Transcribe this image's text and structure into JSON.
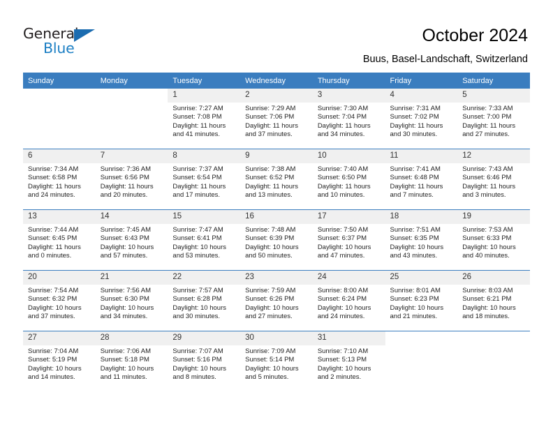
{
  "brand": {
    "name_top": "General",
    "name_bottom": "Blue",
    "color_dark": "#231f20",
    "color_blue": "#1c7fc4",
    "triangle_color": "#1b6cb0"
  },
  "header": {
    "title": "October 2024",
    "subtitle": "Buus, Basel-Landschaft, Switzerland"
  },
  "theme": {
    "header_row_bg": "#3a7dbf",
    "daynum_bg": "#f0f0f0",
    "grid_line": "#3a7dbf"
  },
  "weekdays": [
    "Sunday",
    "Monday",
    "Tuesday",
    "Wednesday",
    "Thursday",
    "Friday",
    "Saturday"
  ],
  "weeks": [
    [
      {
        "day": "",
        "empty": true
      },
      {
        "day": "",
        "empty": true
      },
      {
        "day": "1",
        "sunrise": "Sunrise: 7:27 AM",
        "sunset": "Sunset: 7:08 PM",
        "daylight1": "Daylight: 11 hours",
        "daylight2": "and 41 minutes."
      },
      {
        "day": "2",
        "sunrise": "Sunrise: 7:29 AM",
        "sunset": "Sunset: 7:06 PM",
        "daylight1": "Daylight: 11 hours",
        "daylight2": "and 37 minutes."
      },
      {
        "day": "3",
        "sunrise": "Sunrise: 7:30 AM",
        "sunset": "Sunset: 7:04 PM",
        "daylight1": "Daylight: 11 hours",
        "daylight2": "and 34 minutes."
      },
      {
        "day": "4",
        "sunrise": "Sunrise: 7:31 AM",
        "sunset": "Sunset: 7:02 PM",
        "daylight1": "Daylight: 11 hours",
        "daylight2": "and 30 minutes."
      },
      {
        "day": "5",
        "sunrise": "Sunrise: 7:33 AM",
        "sunset": "Sunset: 7:00 PM",
        "daylight1": "Daylight: 11 hours",
        "daylight2": "and 27 minutes."
      }
    ],
    [
      {
        "day": "6",
        "sunrise": "Sunrise: 7:34 AM",
        "sunset": "Sunset: 6:58 PM",
        "daylight1": "Daylight: 11 hours",
        "daylight2": "and 24 minutes."
      },
      {
        "day": "7",
        "sunrise": "Sunrise: 7:36 AM",
        "sunset": "Sunset: 6:56 PM",
        "daylight1": "Daylight: 11 hours",
        "daylight2": "and 20 minutes."
      },
      {
        "day": "8",
        "sunrise": "Sunrise: 7:37 AM",
        "sunset": "Sunset: 6:54 PM",
        "daylight1": "Daylight: 11 hours",
        "daylight2": "and 17 minutes."
      },
      {
        "day": "9",
        "sunrise": "Sunrise: 7:38 AM",
        "sunset": "Sunset: 6:52 PM",
        "daylight1": "Daylight: 11 hours",
        "daylight2": "and 13 minutes."
      },
      {
        "day": "10",
        "sunrise": "Sunrise: 7:40 AM",
        "sunset": "Sunset: 6:50 PM",
        "daylight1": "Daylight: 11 hours",
        "daylight2": "and 10 minutes."
      },
      {
        "day": "11",
        "sunrise": "Sunrise: 7:41 AM",
        "sunset": "Sunset: 6:48 PM",
        "daylight1": "Daylight: 11 hours",
        "daylight2": "and 7 minutes."
      },
      {
        "day": "12",
        "sunrise": "Sunrise: 7:43 AM",
        "sunset": "Sunset: 6:46 PM",
        "daylight1": "Daylight: 11 hours",
        "daylight2": "and 3 minutes."
      }
    ],
    [
      {
        "day": "13",
        "sunrise": "Sunrise: 7:44 AM",
        "sunset": "Sunset: 6:45 PM",
        "daylight1": "Daylight: 11 hours",
        "daylight2": "and 0 minutes."
      },
      {
        "day": "14",
        "sunrise": "Sunrise: 7:45 AM",
        "sunset": "Sunset: 6:43 PM",
        "daylight1": "Daylight: 10 hours",
        "daylight2": "and 57 minutes."
      },
      {
        "day": "15",
        "sunrise": "Sunrise: 7:47 AM",
        "sunset": "Sunset: 6:41 PM",
        "daylight1": "Daylight: 10 hours",
        "daylight2": "and 53 minutes."
      },
      {
        "day": "16",
        "sunrise": "Sunrise: 7:48 AM",
        "sunset": "Sunset: 6:39 PM",
        "daylight1": "Daylight: 10 hours",
        "daylight2": "and 50 minutes."
      },
      {
        "day": "17",
        "sunrise": "Sunrise: 7:50 AM",
        "sunset": "Sunset: 6:37 PM",
        "daylight1": "Daylight: 10 hours",
        "daylight2": "and 47 minutes."
      },
      {
        "day": "18",
        "sunrise": "Sunrise: 7:51 AM",
        "sunset": "Sunset: 6:35 PM",
        "daylight1": "Daylight: 10 hours",
        "daylight2": "and 43 minutes."
      },
      {
        "day": "19",
        "sunrise": "Sunrise: 7:53 AM",
        "sunset": "Sunset: 6:33 PM",
        "daylight1": "Daylight: 10 hours",
        "daylight2": "and 40 minutes."
      }
    ],
    [
      {
        "day": "20",
        "sunrise": "Sunrise: 7:54 AM",
        "sunset": "Sunset: 6:32 PM",
        "daylight1": "Daylight: 10 hours",
        "daylight2": "and 37 minutes."
      },
      {
        "day": "21",
        "sunrise": "Sunrise: 7:56 AM",
        "sunset": "Sunset: 6:30 PM",
        "daylight1": "Daylight: 10 hours",
        "daylight2": "and 34 minutes."
      },
      {
        "day": "22",
        "sunrise": "Sunrise: 7:57 AM",
        "sunset": "Sunset: 6:28 PM",
        "daylight1": "Daylight: 10 hours",
        "daylight2": "and 30 minutes."
      },
      {
        "day": "23",
        "sunrise": "Sunrise: 7:59 AM",
        "sunset": "Sunset: 6:26 PM",
        "daylight1": "Daylight: 10 hours",
        "daylight2": "and 27 minutes."
      },
      {
        "day": "24",
        "sunrise": "Sunrise: 8:00 AM",
        "sunset": "Sunset: 6:24 PM",
        "daylight1": "Daylight: 10 hours",
        "daylight2": "and 24 minutes."
      },
      {
        "day": "25",
        "sunrise": "Sunrise: 8:01 AM",
        "sunset": "Sunset: 6:23 PM",
        "daylight1": "Daylight: 10 hours",
        "daylight2": "and 21 minutes."
      },
      {
        "day": "26",
        "sunrise": "Sunrise: 8:03 AM",
        "sunset": "Sunset: 6:21 PM",
        "daylight1": "Daylight: 10 hours",
        "daylight2": "and 18 minutes."
      }
    ],
    [
      {
        "day": "27",
        "sunrise": "Sunrise: 7:04 AM",
        "sunset": "Sunset: 5:19 PM",
        "daylight1": "Daylight: 10 hours",
        "daylight2": "and 14 minutes."
      },
      {
        "day": "28",
        "sunrise": "Sunrise: 7:06 AM",
        "sunset": "Sunset: 5:18 PM",
        "daylight1": "Daylight: 10 hours",
        "daylight2": "and 11 minutes."
      },
      {
        "day": "29",
        "sunrise": "Sunrise: 7:07 AM",
        "sunset": "Sunset: 5:16 PM",
        "daylight1": "Daylight: 10 hours",
        "daylight2": "and 8 minutes."
      },
      {
        "day": "30",
        "sunrise": "Sunrise: 7:09 AM",
        "sunset": "Sunset: 5:14 PM",
        "daylight1": "Daylight: 10 hours",
        "daylight2": "and 5 minutes."
      },
      {
        "day": "31",
        "sunrise": "Sunrise: 7:10 AM",
        "sunset": "Sunset: 5:13 PM",
        "daylight1": "Daylight: 10 hours",
        "daylight2": "and 2 minutes."
      },
      {
        "day": "",
        "empty": true
      },
      {
        "day": "",
        "empty": true
      }
    ]
  ]
}
